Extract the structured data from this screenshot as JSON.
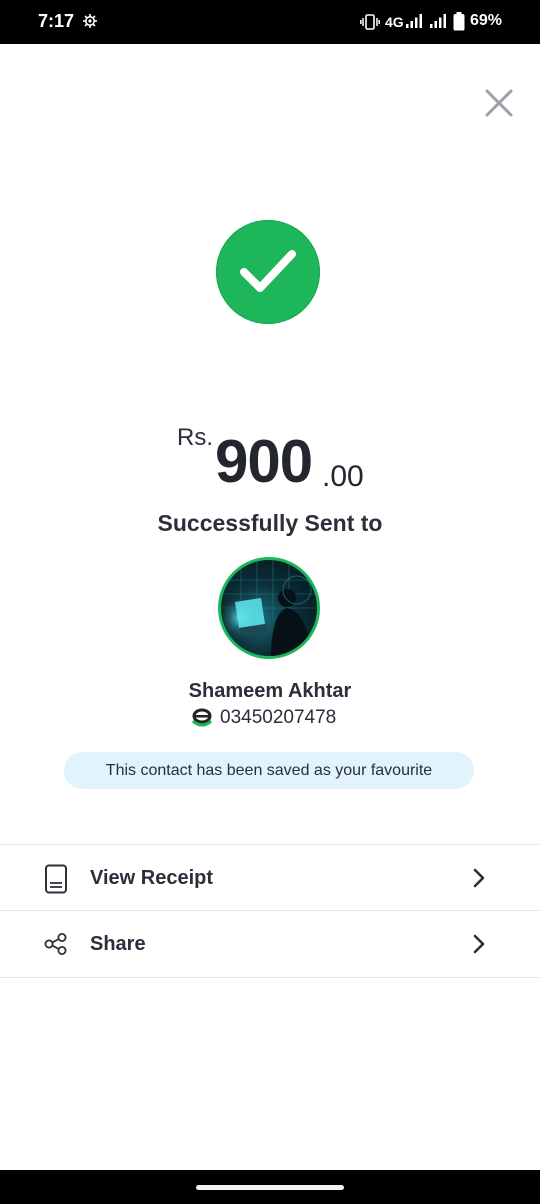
{
  "status_bar": {
    "time": "7:17",
    "network": "4G",
    "battery_percent": "69%",
    "icons": [
      "settings-gear-icon",
      "vibrate-icon",
      "signal-icon",
      "signal-icon",
      "battery-icon"
    ]
  },
  "header": {
    "close_icon": "close-icon"
  },
  "payment": {
    "currency": "Rs.",
    "amount_main": "900",
    "amount_decimal": ".00",
    "status_text": "Successfully Sent to"
  },
  "contact": {
    "name": "Shameem Akhtar",
    "number": "03450207478",
    "favourite_note": "This contact has been saved as your favourite"
  },
  "actions": [
    {
      "label": "View Receipt",
      "icon": "receipt-icon"
    },
    {
      "label": "Share",
      "icon": "share-icon"
    }
  ],
  "colors": {
    "success_green": "#1eb65a",
    "pill_bg": "#e1f3fb",
    "text": "#2b2f3a"
  }
}
